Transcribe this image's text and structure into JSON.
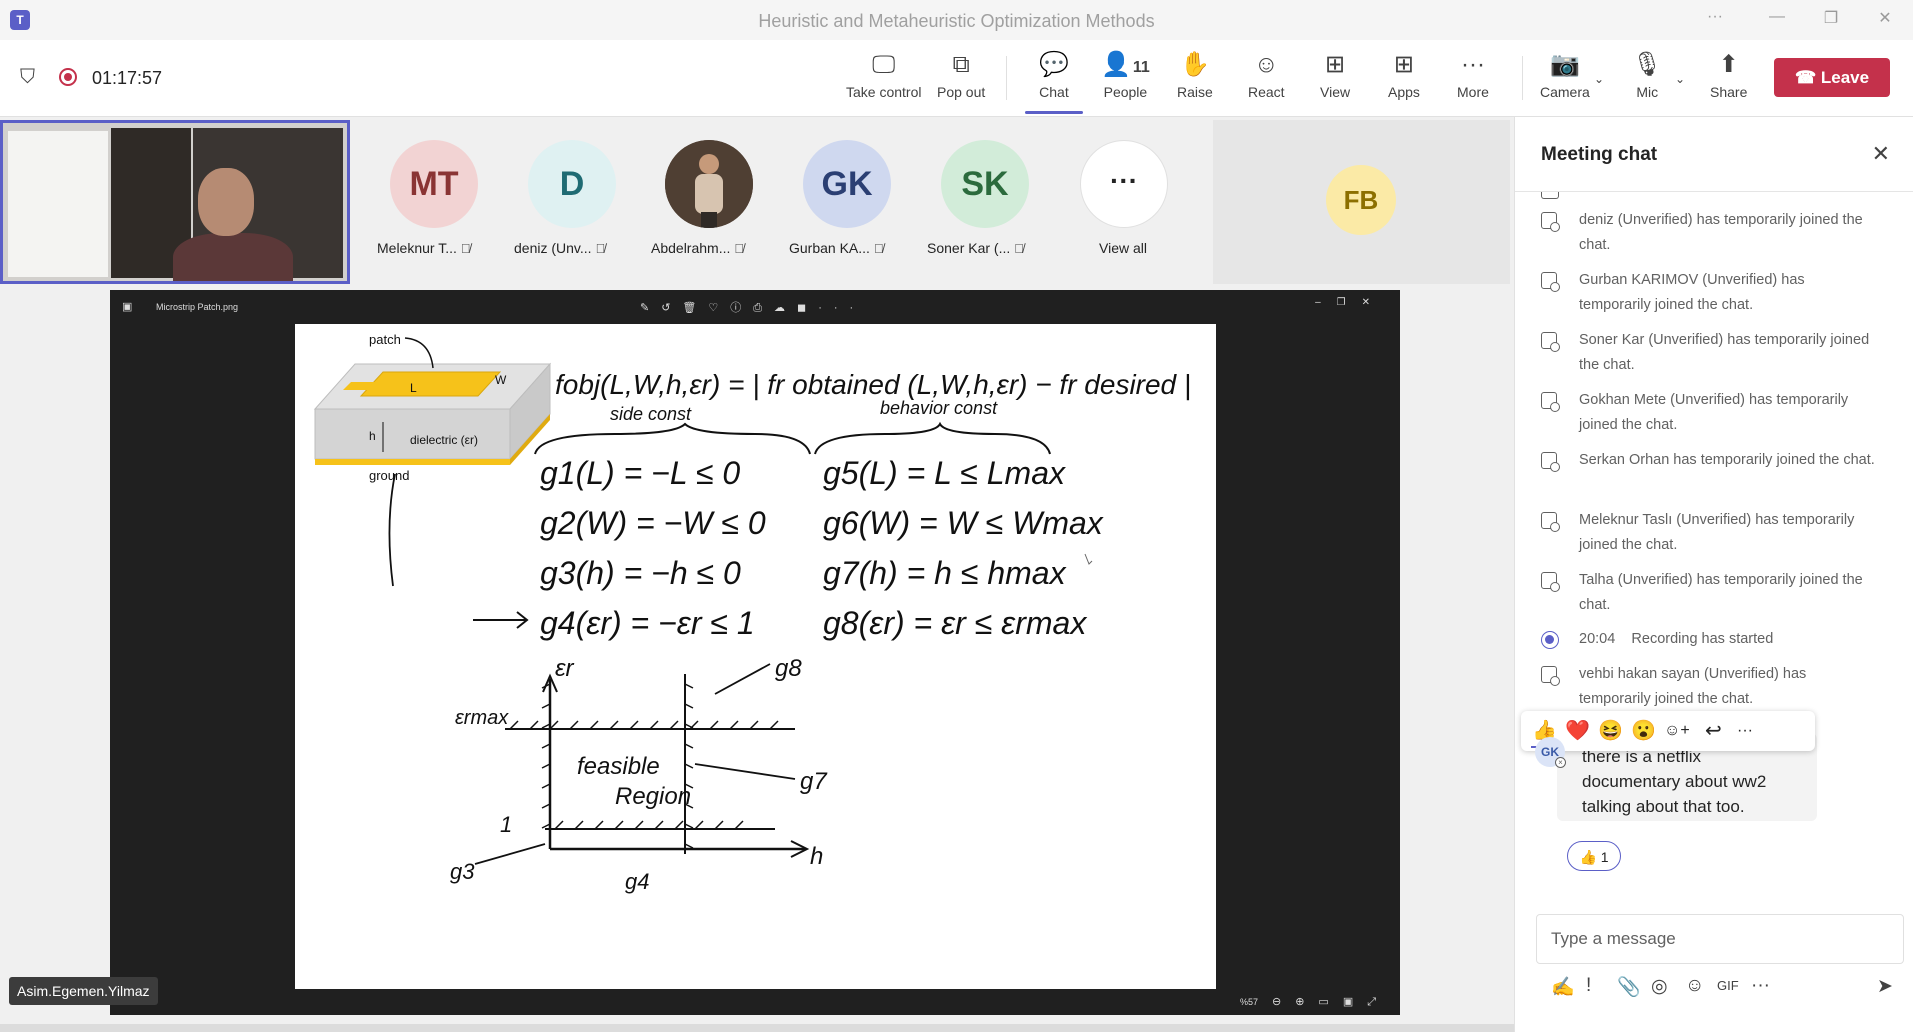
{
  "window": {
    "title": "Heuristic and Metaheuristic Optimization Methods",
    "controls": [
      "···",
      "—",
      "❐",
      "✕"
    ]
  },
  "toolbar": {
    "recording_time": "01:17:57",
    "buttons": {
      "take_control": "Take control",
      "pop_out": "Pop out",
      "chat": "Chat",
      "people": "People",
      "people_count": "11",
      "raise": "Raise",
      "react": "React",
      "view": "View",
      "apps": "Apps",
      "more": "More",
      "camera": "Camera",
      "mic": "Mic",
      "share": "Share",
      "leave": "Leave"
    }
  },
  "participants": [
    {
      "initials": "MT",
      "name": "Meleknur T...",
      "bg": "#f2d3d3",
      "fg": "#8a3434"
    },
    {
      "initials": "D",
      "name": "deniz (Unv...",
      "bg": "#dff1f2",
      "fg": "#1f6b73"
    },
    {
      "initials": "",
      "name": "Abdelrahm...",
      "bg": "#5a4a3e",
      "fg": "#ffffff"
    },
    {
      "initials": "GK",
      "name": "Gurban KA...",
      "bg": "#cfd8ef",
      "fg": "#2b3f73"
    },
    {
      "initials": "SK",
      "name": "Soner Kar (...",
      "bg": "#d2ecd9",
      "fg": "#2b6b3d"
    }
  ],
  "view_all": {
    "icon": "···",
    "label": "View all"
  },
  "fb_tile": {
    "initials": "FB"
  },
  "shared_window": {
    "title": "Microstrip Patch.png",
    "zoom": "%57",
    "whiteboard": {
      "patch_label": "patch",
      "L": "L",
      "W": "W",
      "h": "h",
      "dielectric": "dielectric (εr)",
      "ground": "ground",
      "objective": "fobj(L,W,h,εr) = | fr obtained (L,W,h,εr) − fr desired |",
      "side_const": "side const",
      "behavior_const": "behavior const",
      "g1": "g1(L) = −L ≤ 0",
      "g2": "g2(W) = −W ≤ 0",
      "g3": "g3(h) = −h ≤ 0",
      "g4": "g4(εr) = −εr ≤ 1",
      "g5": "g5(L) = L ≤ Lmax",
      "g6": "g6(W) = W ≤ Wmax",
      "g7": "g7(h) = h ≤ hmax",
      "g8": "g8(εr) = εr ≤ εrmax",
      "er_axis": "εr",
      "ermax": "εrmax",
      "feasible": "feasible",
      "region": "Region",
      "one": "1",
      "h_axis": "h",
      "g3_lbl": "g3",
      "g4_lbl": "g4",
      "g7_lbl": "g7",
      "g8_lbl": "g8"
    }
  },
  "presenter_name": "Asim.Egemen.Yilmaz",
  "chat": {
    "title": "Meeting chat",
    "system_messages": [
      {
        "text": "deniz (Unverified) has temporarily joined the chat."
      },
      {
        "text": "Gurban KARIMOV (Unverified) has temporarily joined the chat."
      },
      {
        "text": "Soner Kar (Unverified) has temporarily joined the chat."
      },
      {
        "text": "Gokhan Mete (Unverified) has temporarily joined the chat."
      },
      {
        "text": "Serkan Orhan has temporarily joined the chat."
      },
      {
        "text": "Meleknur Taslı (Unverified) has temporarily joined the chat."
      },
      {
        "text": "Talha (Unverified) has temporarily joined the chat."
      }
    ],
    "recording": {
      "time": "20:04",
      "text": "Recording has started"
    },
    "last_join": "vehbi hakan sayan (Unverified) has temporarily joined the chat.",
    "reactions_bar": [
      "👍",
      "❤️",
      "😆",
      "😮",
      "☺+",
      "↩",
      "···"
    ],
    "message": {
      "avatar": "GK",
      "text": "there is a netflix documentary about ww2 talking about that too.",
      "reaction": "👍 1"
    },
    "compose_placeholder": "Type a message"
  },
  "colors": {
    "accent": "#5b5fc7",
    "leave": "#c4314b",
    "gold": "#f6c21a"
  }
}
